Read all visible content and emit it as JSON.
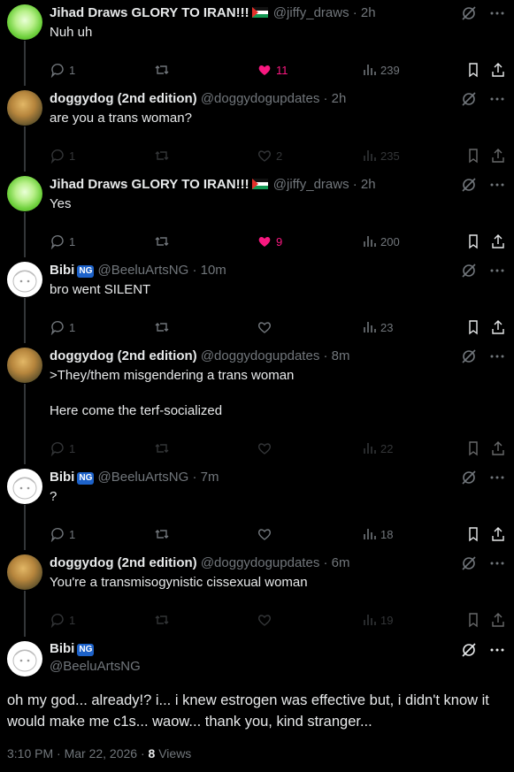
{
  "replies": [
    {
      "name": "Jihad Draws GLORY TO IRAN!!!",
      "flag": true,
      "ng": false,
      "handle": "@jiffy_draws",
      "time": "· 2h",
      "text": "Nuh uh",
      "replies": "1",
      "likes": "11",
      "liked": true,
      "views": "239",
      "avatar": "green"
    },
    {
      "name": "doggydog (2nd edition)",
      "flag": false,
      "ng": false,
      "handle": "@doggydogupdates",
      "time": "· 2h",
      "text": "are you a trans woman?",
      "replies": "1",
      "likes": "2",
      "liked": false,
      "views": "235",
      "avatar": "dog"
    },
    {
      "name": "Jihad Draws GLORY TO IRAN!!!",
      "flag": true,
      "ng": false,
      "handle": "@jiffy_draws",
      "time": "· 2h",
      "text": "Yes",
      "replies": "1",
      "likes": "9",
      "liked": true,
      "views": "200",
      "avatar": "green"
    },
    {
      "name": "Bibi",
      "flag": false,
      "ng": true,
      "handle": "@BeeluArtsNG",
      "time": "· 10m",
      "text": "bro went SILENT",
      "replies": "1",
      "likes": "",
      "liked": false,
      "views": "23",
      "avatar": "bibi"
    },
    {
      "name": "doggydog (2nd edition)",
      "flag": false,
      "ng": false,
      "handle": "@doggydogupdates",
      "time": "· 8m",
      "text": ">They/them misgendering a trans woman\n\nHere come the terf-socialized",
      "replies": "1",
      "likes": "",
      "liked": false,
      "views": "22",
      "avatar": "dog"
    },
    {
      "name": "Bibi",
      "flag": false,
      "ng": true,
      "handle": "@BeeluArtsNG",
      "time": "· 7m",
      "text": "?",
      "replies": "1",
      "likes": "",
      "liked": false,
      "views": "18",
      "avatar": "bibi"
    },
    {
      "name": "doggydog (2nd edition)",
      "flag": false,
      "ng": false,
      "handle": "@doggydogupdates",
      "time": "· 6m",
      "text": "You're a transmisogynistic cissexual woman",
      "replies": "1",
      "likes": "",
      "liked": false,
      "views": "19",
      "avatar": "dog"
    }
  ],
  "main": {
    "name": "Bibi",
    "ng_badge": "NG",
    "handle": "@BeeluArtsNG",
    "text": "oh my god... already!? i... i knew estrogen was effective but, i didn't know it would make me c1s... waow... thank you, kind stranger...",
    "time": "3:10 PM · Mar 22, 2026 ·",
    "views_count": "8",
    "views_label": "Views"
  },
  "colors": {
    "like": "#f91880",
    "muted": "#71767b",
    "text": "#e7e9ea",
    "badge": "#1d62c9"
  }
}
